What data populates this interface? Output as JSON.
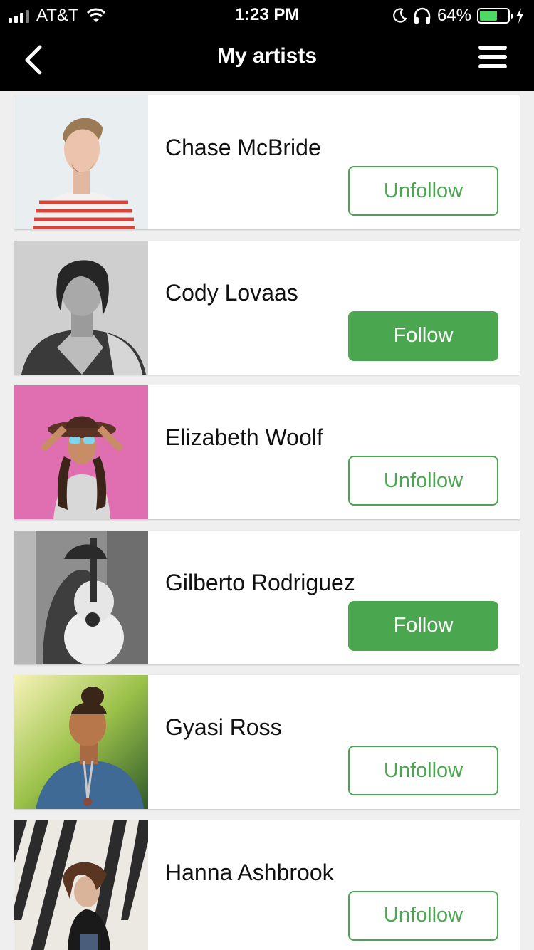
{
  "status_bar": {
    "carrier": "AT&T",
    "time": "1:23 PM",
    "battery_percent": "64%",
    "battery_level": 0.64
  },
  "nav": {
    "title": "My artists",
    "back_icon": "chevron-left-icon",
    "menu_icon": "hamburger-menu-icon"
  },
  "colors": {
    "accent": "#4aa750",
    "header_bg": "#000000",
    "page_bg": "#efefef"
  },
  "artists": [
    {
      "name": "Chase McBride",
      "button": "Unfollow",
      "following": true
    },
    {
      "name": "Cody Lovaas",
      "button": "Follow",
      "following": false
    },
    {
      "name": "Elizabeth Woolf",
      "button": "Unfollow",
      "following": true
    },
    {
      "name": "Gilberto Rodriguez",
      "button": "Follow",
      "following": false
    },
    {
      "name": "Gyasi Ross",
      "button": "Unfollow",
      "following": true
    },
    {
      "name": "Hanna Ashbrook",
      "button": "Unfollow",
      "following": true
    }
  ]
}
